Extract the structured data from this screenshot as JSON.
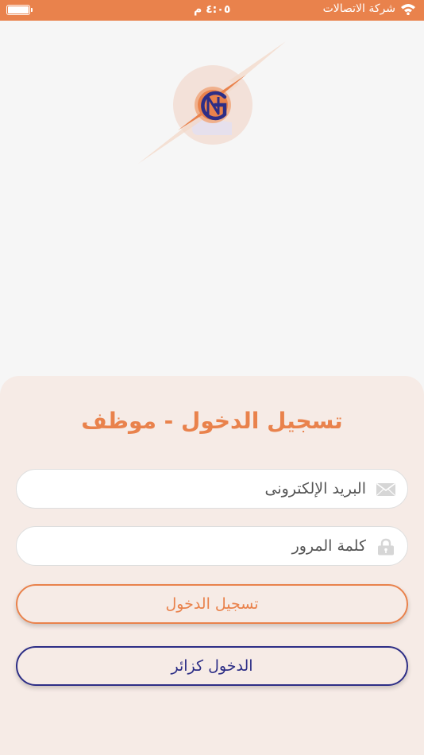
{
  "status_bar": {
    "carrier": "شركة الاتصالات",
    "time": "٤:٠٥ م"
  },
  "login": {
    "title": "تسجيل الدخول - موظف",
    "email_placeholder": "البريد الإلكترونى",
    "password_placeholder": "كلمة المرور",
    "login_label": "تسجيل الدخول",
    "guest_label": "الدخول كزائر"
  },
  "icons": {
    "email": "envelope-icon",
    "password": "lock-icon",
    "wifi": "wifi-icon",
    "battery": "battery-icon"
  },
  "colors": {
    "accent": "#e9824c",
    "navy": "#2d2e86",
    "panel": "#f6ebe6",
    "background": "#f6f6f6"
  }
}
